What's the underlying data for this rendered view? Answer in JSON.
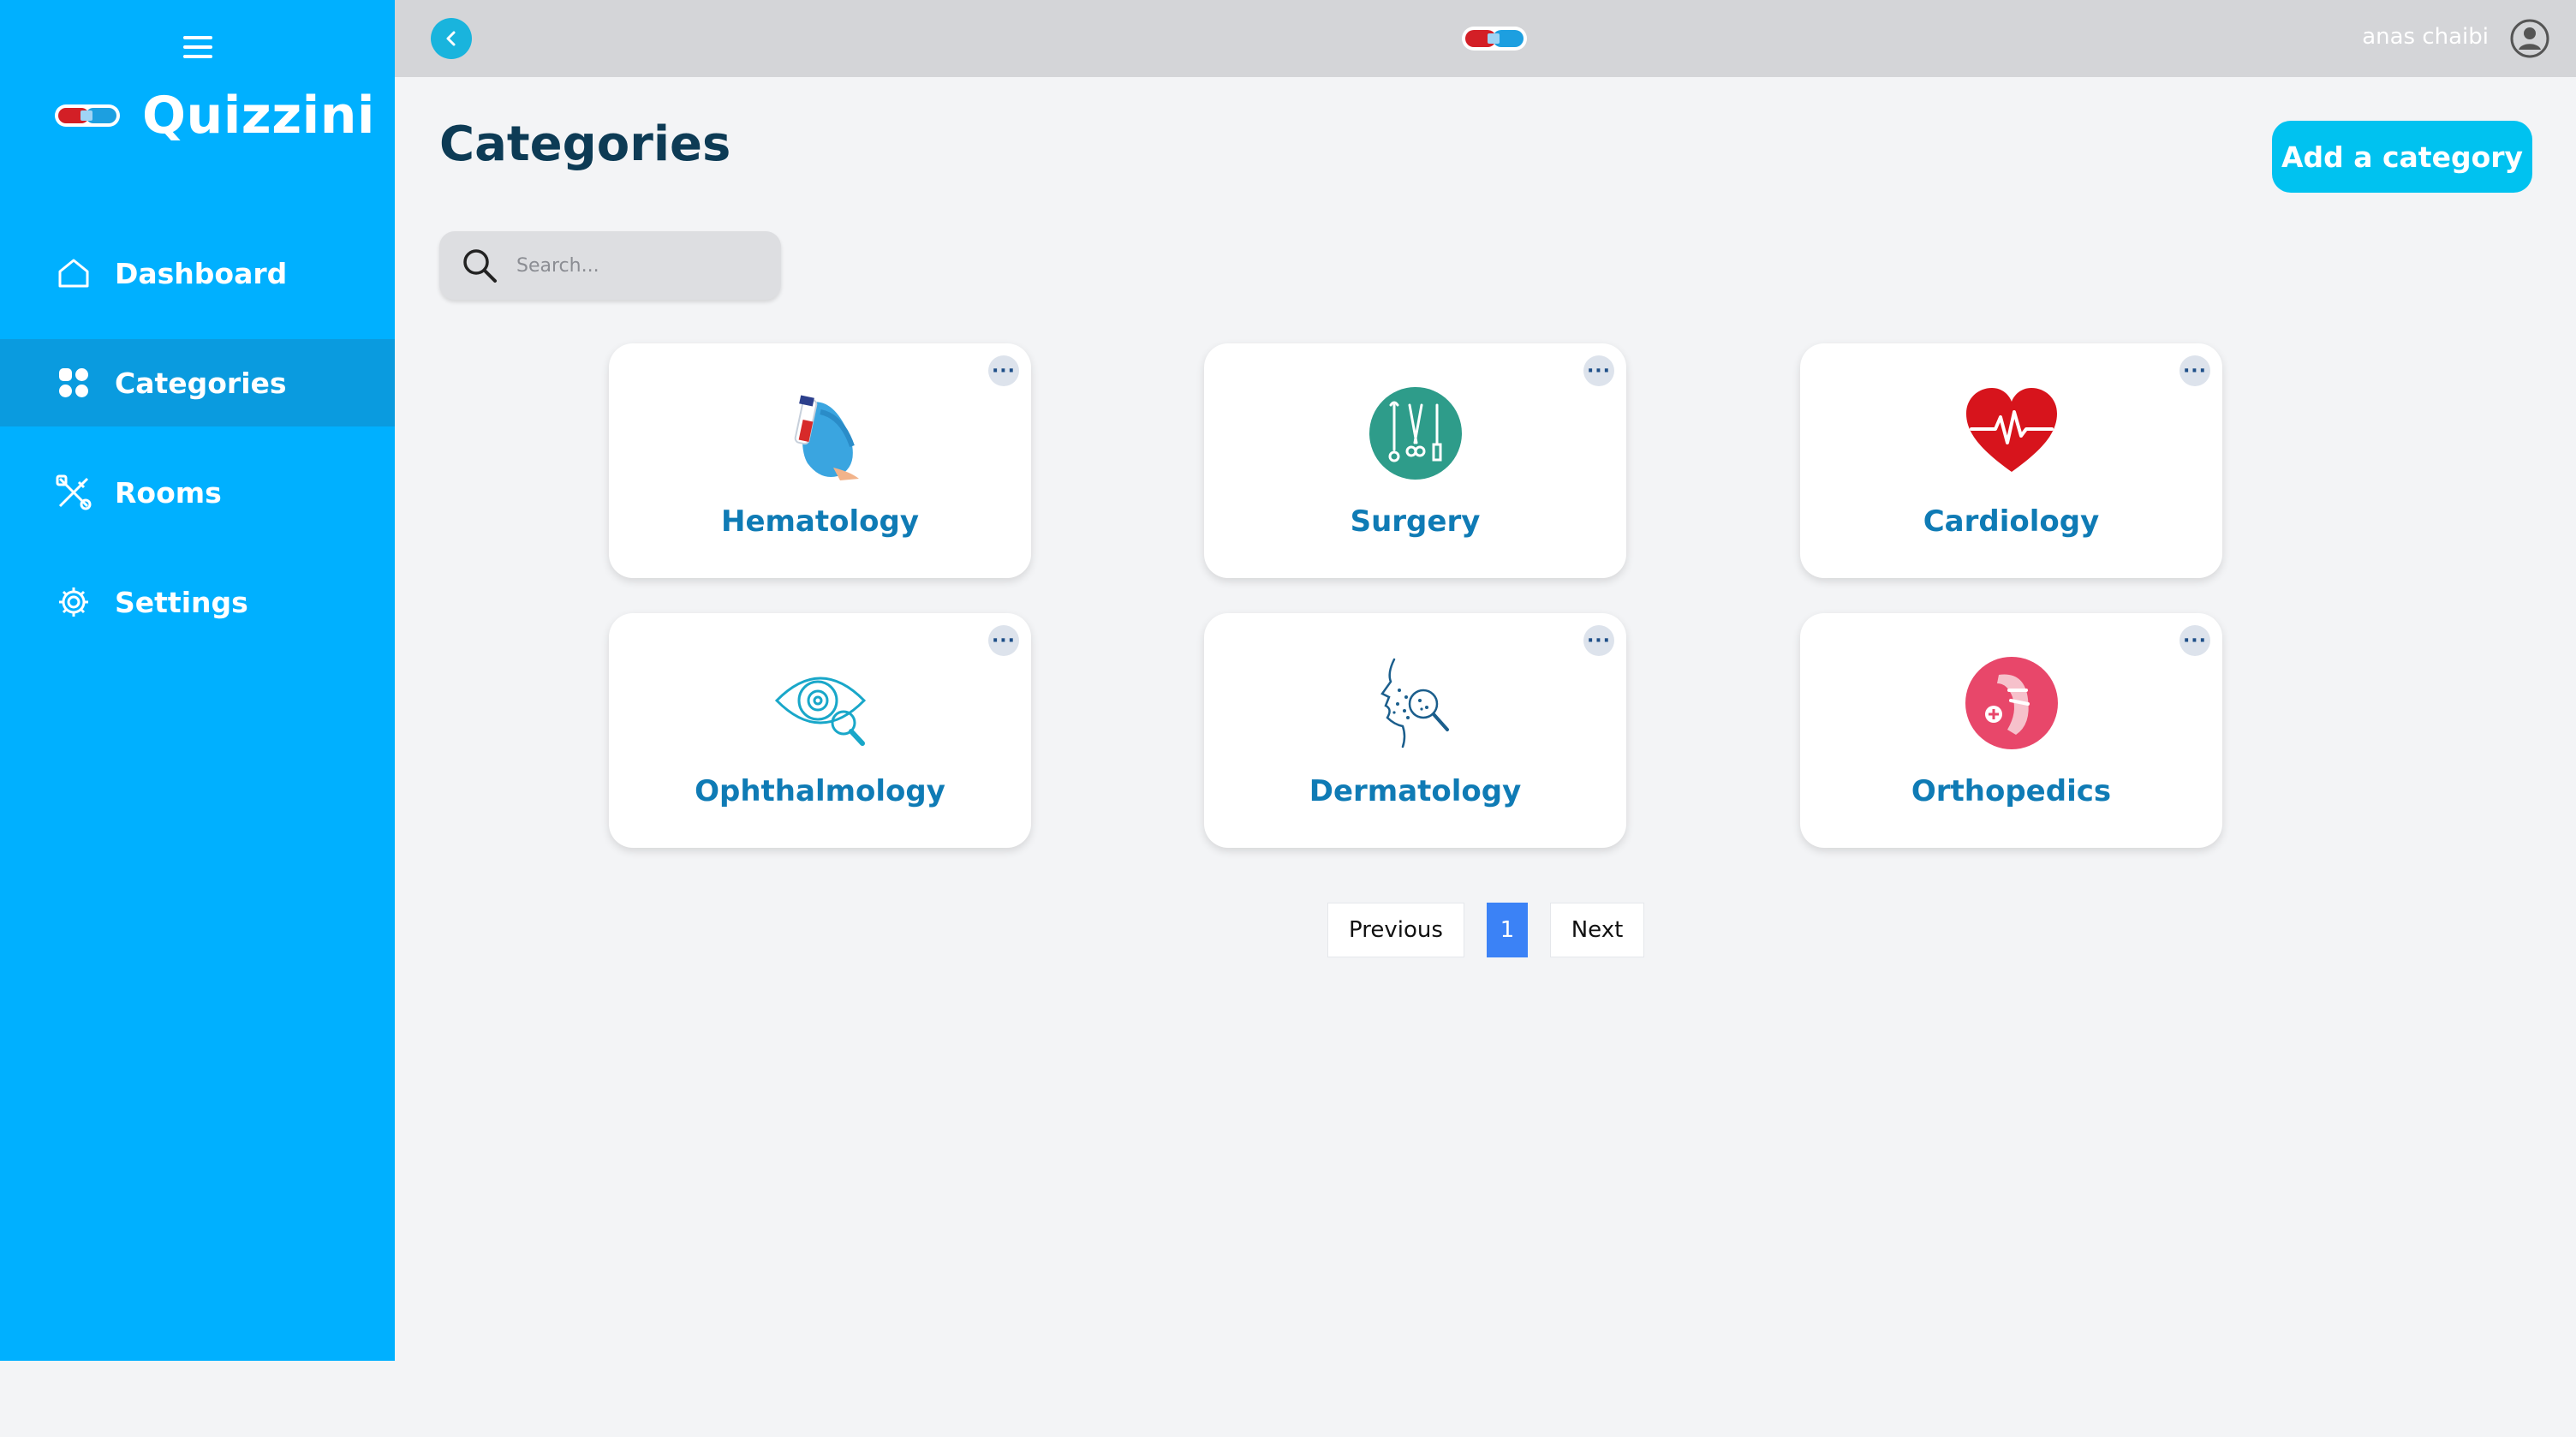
{
  "app": {
    "name": "Quizzini"
  },
  "colors": {
    "sidebar": "#00b0ff",
    "accent": "#00c2f0",
    "title": "#0d3b55",
    "card_label": "#0f7bb5",
    "page_active": "#3b82f6"
  },
  "sidebar": {
    "items": [
      {
        "label": "Dashboard",
        "icon": "home-icon"
      },
      {
        "label": "Categories",
        "icon": "grid-icon",
        "active": true
      },
      {
        "label": "Rooms",
        "icon": "tools-icon"
      },
      {
        "label": "Settings",
        "icon": "gear-icon"
      }
    ]
  },
  "topbar": {
    "user_name": "anas chaibi"
  },
  "main": {
    "title": "Categories",
    "add_button": "Add a category",
    "search_placeholder": "Search...",
    "categories": [
      {
        "label": "Hematology",
        "icon": "blood-tube-glove-icon",
        "more": "···"
      },
      {
        "label": "Surgery",
        "icon": "surgical-tools-icon",
        "more": "···"
      },
      {
        "label": "Cardiology",
        "icon": "heart-pulse-icon",
        "more": "···"
      },
      {
        "label": "Ophthalmology",
        "icon": "eye-magnifier-icon",
        "more": "···"
      },
      {
        "label": "Dermatology",
        "icon": "face-magnifier-icon",
        "more": "···"
      },
      {
        "label": "Orthopedics",
        "icon": "knee-joint-icon",
        "more": "···"
      }
    ],
    "pagination": {
      "previous": "Previous",
      "current": "1",
      "next": "Next"
    }
  }
}
